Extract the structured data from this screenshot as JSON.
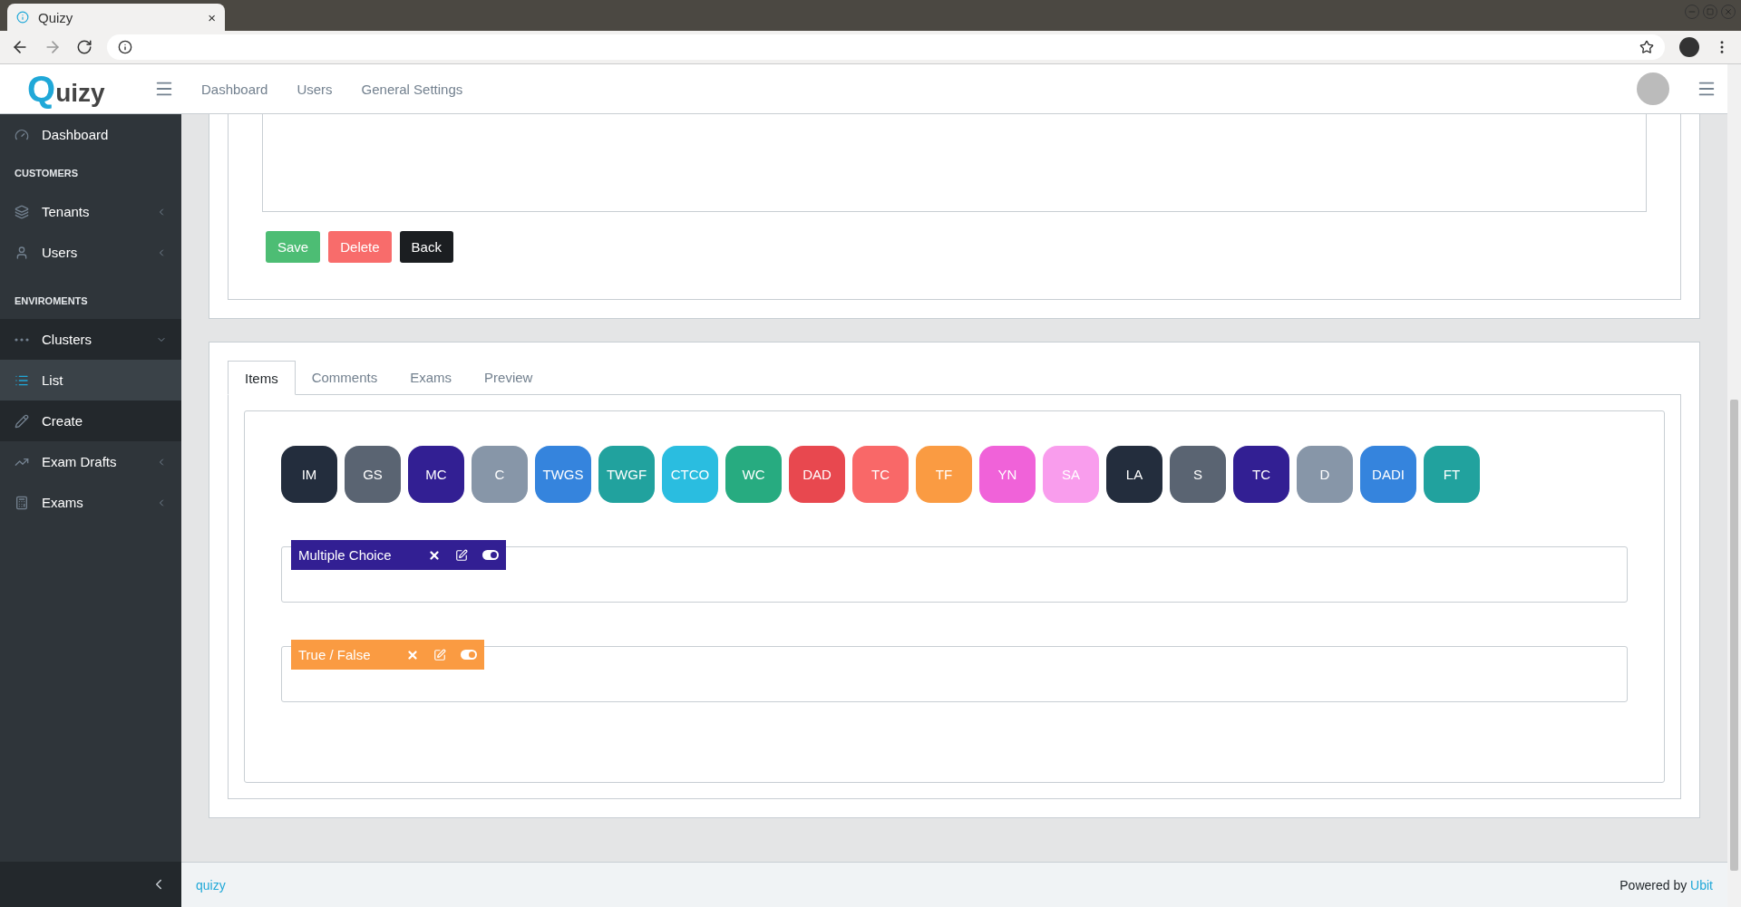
{
  "browser": {
    "tab_title": "Quizy",
    "close": "×"
  },
  "header": {
    "logo": "Quizy",
    "nav": [
      "Dashboard",
      "Users",
      "General Settings"
    ]
  },
  "sidebar": {
    "items": [
      {
        "kind": "link",
        "label": "Dashboard"
      },
      {
        "kind": "heading",
        "label": "CUSTOMERS"
      },
      {
        "kind": "group",
        "label": "Tenants",
        "expanded": false
      },
      {
        "kind": "group",
        "label": "Users",
        "expanded": false
      },
      {
        "kind": "heading",
        "label": "ENVIROMENTS"
      },
      {
        "kind": "group",
        "label": "Clusters",
        "expanded": true,
        "children": [
          {
            "label": "List",
            "selected": true
          },
          {
            "label": "Create",
            "selected": false
          }
        ]
      },
      {
        "kind": "group",
        "label": "Exam Drafts",
        "expanded": false
      },
      {
        "kind": "group",
        "label": "Exams",
        "expanded": false
      }
    ]
  },
  "form": {
    "buttons": [
      {
        "kind": "success",
        "label": "Save"
      },
      {
        "kind": "danger",
        "label": "Delete"
      },
      {
        "kind": "dark",
        "label": "Back"
      }
    ]
  },
  "tabs": [
    {
      "label": "Items",
      "selected": true
    },
    {
      "label": "Comments",
      "selected": false
    },
    {
      "label": "Exams",
      "selected": false
    },
    {
      "label": "Preview",
      "selected": false
    }
  ],
  "item_types": [
    {
      "label": "IM",
      "color": "#232d3d"
    },
    {
      "label": "GS",
      "color": "#5a6472"
    },
    {
      "label": "MC",
      "color": "#321f93"
    },
    {
      "label": "C",
      "color": "#8796a8"
    },
    {
      "label": "TWGS",
      "color": "#3584dd"
    },
    {
      "label": "TWGF",
      "color": "#21a29e"
    },
    {
      "label": "CTCO",
      "color": "#2abde0"
    },
    {
      "label": "WC",
      "color": "#27ab80"
    },
    {
      "label": "DAD",
      "color": "#e8484f"
    },
    {
      "label": "TC",
      "color": "#f96868"
    },
    {
      "label": "TF",
      "color": "#fa9b42"
    },
    {
      "label": "YN",
      "color": "#f062d9"
    },
    {
      "label": "SA",
      "color": "#f99ded"
    },
    {
      "label": "LA",
      "color": "#232d3d"
    },
    {
      "label": "S",
      "color": "#5a6472"
    },
    {
      "label": "TC",
      "color": "#321f93"
    },
    {
      "label": "D",
      "color": "#8796a8"
    },
    {
      "label": "DADI",
      "color": "#3584dd"
    },
    {
      "label": "FT",
      "color": "#21a29e"
    }
  ],
  "questions": [
    {
      "title": "Multiple Choice",
      "color": "#321f93",
      "on": true
    },
    {
      "title": "True / False",
      "color": "#fa9b42",
      "on": true
    }
  ],
  "footer": {
    "brand": "quizy",
    "powered_by": "Powered by",
    "company": "Ubit"
  }
}
